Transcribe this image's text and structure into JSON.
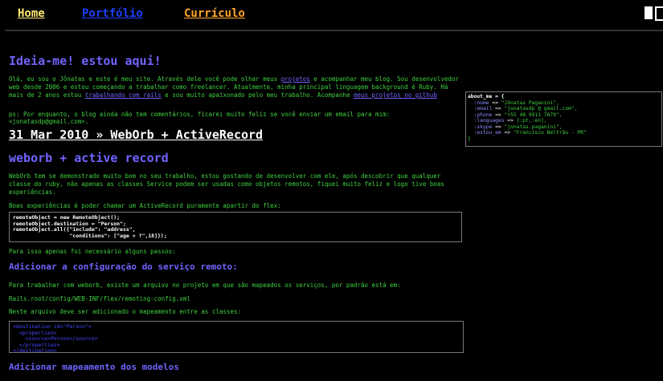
{
  "nav": {
    "home": "Home",
    "portfolio": "Portfólio",
    "curriculo": "Currículo"
  },
  "tagline": "Ideia-me! estou aqui!",
  "intro": {
    "text1": "Olá, eu sou o Jônatas e este é meu site. Através dele você pode olhar meus ",
    "link_projetos": "projetos",
    "text2": " e acompanhar meu blog. Sou desenvolvedor web desde 2006 e estou começando a trabalhar como freelancer. Atualmente, minha principal linguagem background é Ruby. Há mais de 2 anos estou ",
    "link_rails": "trabalhando com rails",
    "text3": " e sou muito apaixonado pelo meu trabalho. Acompanhe ",
    "link_github": "meus projetos no github"
  },
  "ps": "ps: Por enquanto, o blog ainda não tem comentários, ficarei muito feliz se você enviar um email para mim: <jonatasdp@gmail.com>.",
  "post": {
    "date_title": "31 Mar 2010 » WebOrb + ActiveRecord",
    "title": "weborb + active record",
    "p1": "WebOrb tem se demonstrado muito bom no seu trabalho, estou gostando de desenvolver com ele, após descobrir que qualquer classe do ruby, não apenas as classes Service podem ser usadas como objetos remotos, fiquei muito feliz e logo tive boas experiências.",
    "p2": "Boas experiências é poder chamar um ActiveRecord puramente apartir do flex:",
    "code1": [
      "remoteObject = new RemoteObject();",
      "remoteObject.destination = \"Person\";",
      "remoteObject.all({\"include\": \"address\",",
      "                  \"conditions\": [\"age > ?\",18]});"
    ],
    "p3": "Para isso apenas foi necessário alguns passos:",
    "h2a": "Adicionar a configuração do serviço remoto:",
    "p4": "Para trabalhar com weborb, existe um arquivo no projeto em que são mapeados os serviços, por padrão está em:",
    "p5": "Rails.root/config/WEB-INF/flex/remoting-config.xml",
    "p6": "Neste arquivo deve ser adicionado o mapeamento entre as classes:",
    "code2": [
      "<destination id=\"Person\">",
      "  <properties>",
      "    <source>Person</source>",
      "  </properties>",
      "</destination>"
    ],
    "h2b": "Adicionar mapeamento dos modelos"
  },
  "about_me": {
    "header": "about_me = {",
    "rows": [
      {
        "key": ":nome",
        "value": "\"Jônatas Paganini\","
      },
      {
        "key": ":email",
        "value": "\"jonatasdp @ gmail.com\","
      },
      {
        "key": ":phone",
        "value": "\"+55 48 9911 7879\","
      },
      {
        "key": ":languages",
        "value": "[:pt,:en],"
      },
      {
        "key": ":skype",
        "value": "\"jonatas.paganini\","
      },
      {
        "key": ":estou_em",
        "value": "\"Francisco Beltrão - PR\""
      }
    ],
    "footer": "}"
  }
}
